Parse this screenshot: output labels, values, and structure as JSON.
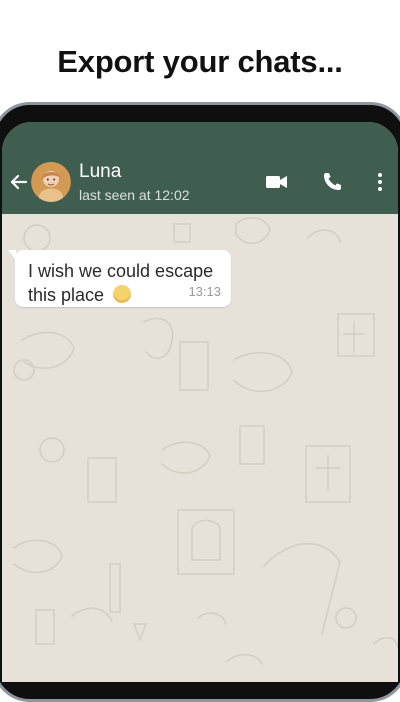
{
  "headline": "Export your chats...",
  "chat": {
    "contact_name": "Luna",
    "last_seen": "last seen at 12:02",
    "message": {
      "text": "I wish we could escape this place",
      "time": "13:13"
    }
  },
  "icons": {
    "back": "back-arrow-icon",
    "video": "video-call-icon",
    "call": "phone-call-icon",
    "more": "more-vertical-icon",
    "emoji": "relieved-face-emoji"
  },
  "colors": {
    "header": "#405e4f",
    "wallpaper": "#e6e1d9",
    "bubble": "#ffffff"
  }
}
